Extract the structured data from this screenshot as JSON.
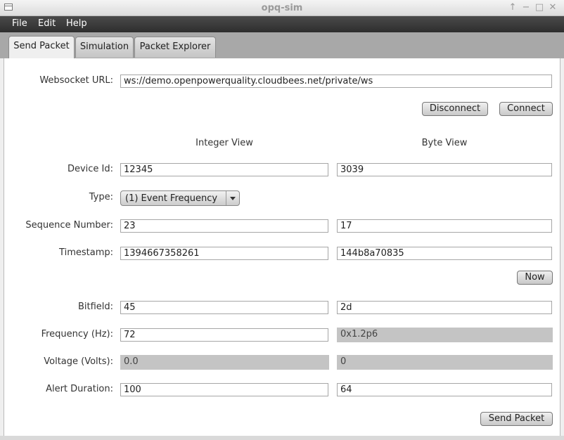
{
  "window": {
    "title": "opq-sim",
    "controls": [
      "↑",
      "−",
      "□",
      "✕"
    ]
  },
  "menu": {
    "file": "File",
    "edit": "Edit",
    "help": "Help"
  },
  "tabs": {
    "send_packet": "Send Packet",
    "simulation": "Simulation",
    "packet_explorer": "Packet Explorer",
    "active": "Send Packet"
  },
  "websocket": {
    "label": "Websocket URL:",
    "url": "ws://demo.openpowerquality.cloudbees.net/private/ws"
  },
  "buttons": {
    "disconnect": "Disconnect",
    "connect": "Connect",
    "now": "Now",
    "send_packet": "Send Packet"
  },
  "headers": {
    "integer_view": "Integer View",
    "byte_view": "Byte View"
  },
  "fields": {
    "device_id": {
      "label": "Device Id:",
      "integer": "12345",
      "byte": "3039"
    },
    "type": {
      "label": "Type:",
      "selected": "(1) Event Frequency"
    },
    "sequence_number": {
      "label": "Sequence Number:",
      "integer": "23",
      "byte": "17"
    },
    "timestamp": {
      "label": "Timestamp:",
      "integer": "1394667358261",
      "byte": "144b8a70835"
    },
    "bitfield": {
      "label": "Bitfield:",
      "integer": "45",
      "byte": "2d"
    },
    "frequency": {
      "label": "Frequency (Hz):",
      "integer": "72",
      "byte": "0x1.2p6"
    },
    "voltage": {
      "label": "Voltage (Volts):",
      "integer": "0.0",
      "byte": "0"
    },
    "alert_duration": {
      "label": "Alert Duration:",
      "integer": "100",
      "byte": "64"
    }
  },
  "colors": {
    "menubar": "#3a3a3a",
    "tabstrip": "#a8a8a8",
    "readonly_field": "#c4c4c4"
  }
}
